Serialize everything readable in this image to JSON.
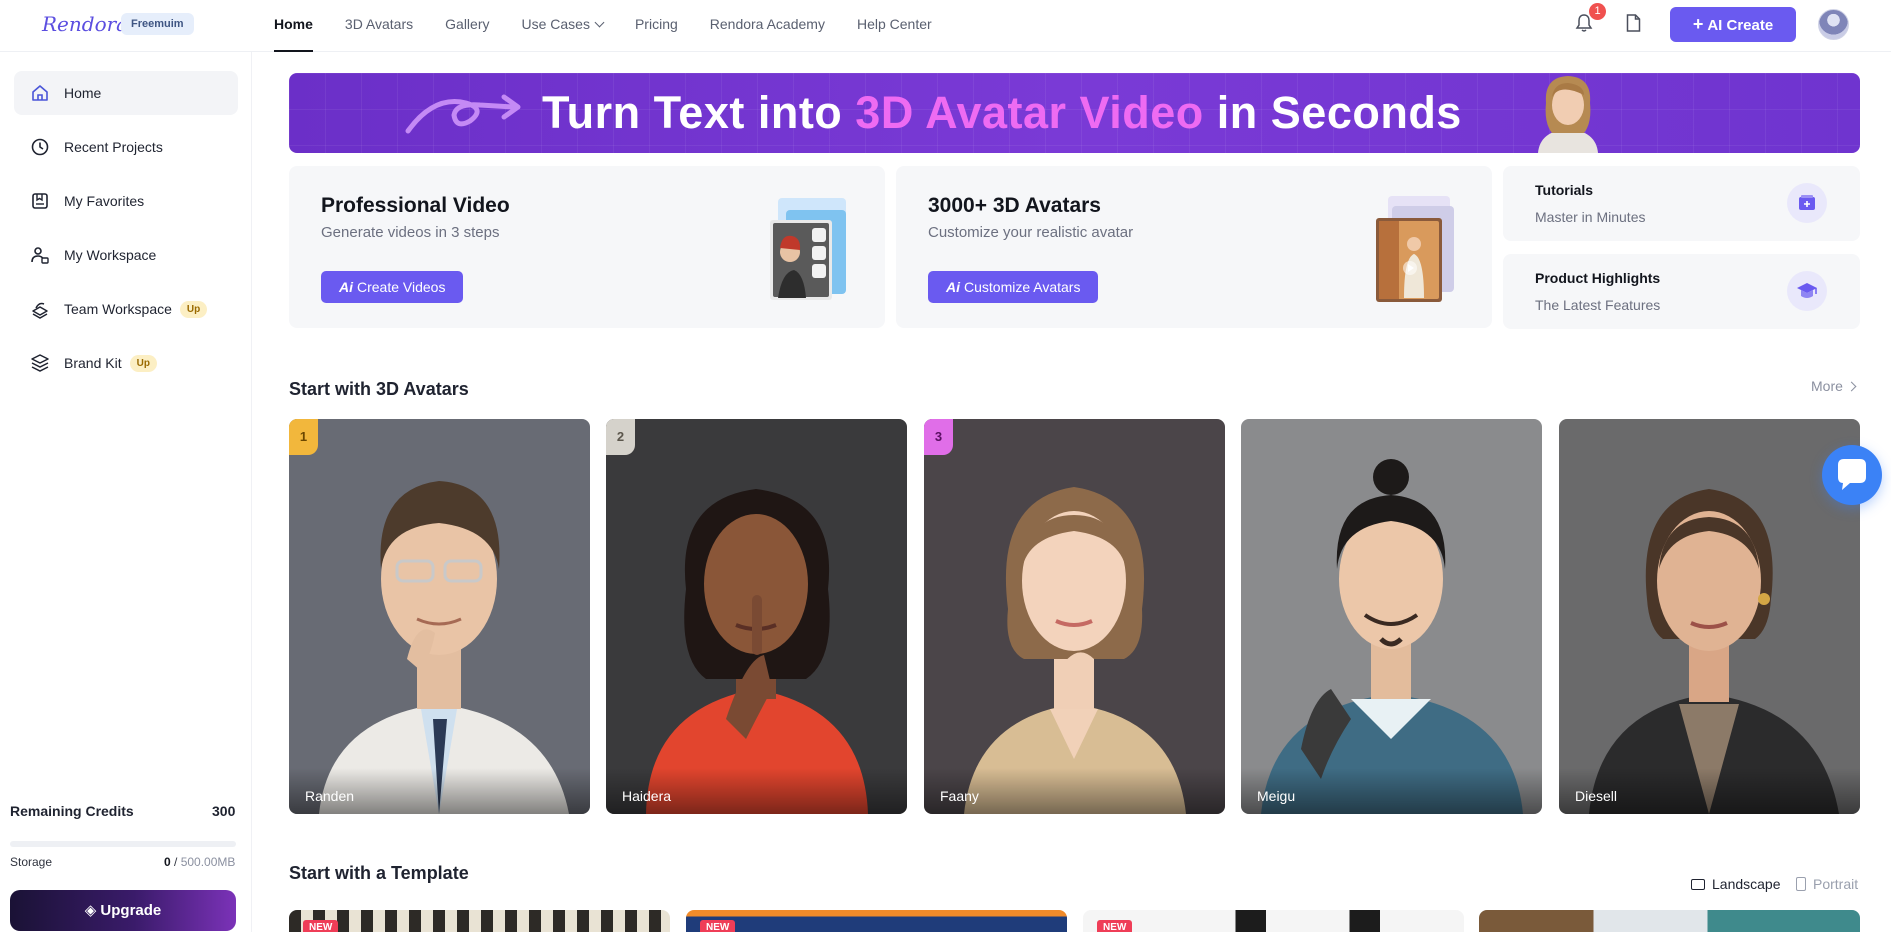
{
  "app": {
    "logo": "Rendora",
    "plan_badge": "Freemuim"
  },
  "nav": {
    "items": [
      {
        "label": "Home",
        "active": true
      },
      {
        "label": "3D Avatars"
      },
      {
        "label": "Gallery"
      },
      {
        "label": "Use Cases",
        "has_dropdown": true
      },
      {
        "label": "Pricing"
      },
      {
        "label": "Rendora Academy"
      },
      {
        "label": "Help Center"
      }
    ],
    "notification_count": "1",
    "ai_create_label": "AI Create",
    "icons": [
      "bell-icon",
      "document-icon",
      "plus-icon",
      "user-avatar"
    ]
  },
  "sidebar": {
    "items": [
      {
        "label": "Home",
        "icon": "home-icon",
        "active": true
      },
      {
        "label": "Recent Projects",
        "icon": "clock-icon"
      },
      {
        "label": "My Favorites",
        "icon": "favorites-icon"
      },
      {
        "label": "My Workspace",
        "icon": "workspace-icon"
      },
      {
        "label": "Team Workspace",
        "icon": "team-icon",
        "badge": "Up"
      },
      {
        "label": "Brand Kit",
        "icon": "layers-icon",
        "badge": "Up"
      }
    ],
    "credits_label": "Remaining Credits",
    "credits_value": "300",
    "storage_label": "Storage",
    "storage_used": "0",
    "storage_sep": " / ",
    "storage_total": "500.00MB",
    "storage_fraction": 0,
    "upgrade_label": "Upgrade"
  },
  "banner": {
    "text_before": "Turn Text into ",
    "text_highlight": "3D Avatar Video",
    "text_after": " in Seconds"
  },
  "cards": [
    {
      "title": "Professional Video",
      "subtitle": "Generate videos in 3 steps",
      "button": "Create Videos",
      "button_prefix": "Ai"
    },
    {
      "title": "3000+ 3D Avatars",
      "subtitle": "Customize your realistic avatar",
      "button": "Customize Avatars",
      "button_prefix": "Ai"
    }
  ],
  "mini_cards": [
    {
      "title": "Tutorials",
      "subtitle": "Master in Minutes",
      "icon": "tutorials-icon"
    },
    {
      "title": "Product Highlights",
      "subtitle": "The Latest Features",
      "icon": "graduation-cap-icon"
    }
  ],
  "avatars_section": {
    "title": "Start with 3D Avatars",
    "more_label": "More",
    "avatars": [
      {
        "name": "Randen",
        "rank": "1"
      },
      {
        "name": "Haidera",
        "rank": "2"
      },
      {
        "name": "Faany",
        "rank": "3"
      },
      {
        "name": "Meigu"
      },
      {
        "name": "Diesell"
      }
    ]
  },
  "template_section": {
    "title": "Start with a Template",
    "orientation": {
      "landscape": "Landscape",
      "portrait": "Portrait",
      "selected": "Landscape"
    },
    "badge_new": "NEW"
  },
  "colors": {
    "accent": "#6a5af0",
    "highlight": "#ee6bf2",
    "chat": "#3b82f6"
  }
}
